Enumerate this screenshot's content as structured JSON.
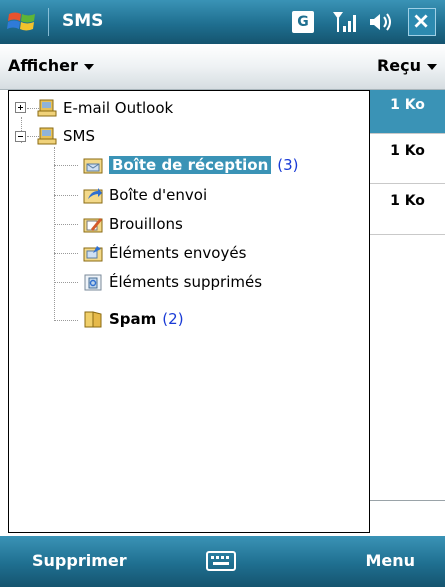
{
  "app": {
    "title": "SMS"
  },
  "status": {
    "network_letter": "G"
  },
  "menubar": {
    "left_label": "Afficher",
    "right_label": "Reçu"
  },
  "tree": {
    "items": [
      {
        "label": "E-mail Outlook",
        "count": "",
        "expand": "plus",
        "level": 0,
        "bold": false,
        "selected": false
      },
      {
        "label": "SMS",
        "count": "",
        "expand": "minus",
        "level": 0,
        "bold": false,
        "selected": false
      },
      {
        "label": "Boîte de réception",
        "count": "(3)",
        "expand": "",
        "level": 1,
        "bold": true,
        "selected": true
      },
      {
        "label": "Boîte d'envoi",
        "count": "",
        "expand": "",
        "level": 1,
        "bold": false,
        "selected": false
      },
      {
        "label": "Brouillons",
        "count": "",
        "expand": "",
        "level": 1,
        "bold": false,
        "selected": false
      },
      {
        "label": "Éléments envoyés",
        "count": "",
        "expand": "",
        "level": 1,
        "bold": false,
        "selected": false
      },
      {
        "label": "Éléments supprimés",
        "count": "",
        "expand": "",
        "level": 1,
        "bold": false,
        "selected": false
      },
      {
        "label": "Spam",
        "count": "(2)",
        "expand": "",
        "level": 1,
        "bold": true,
        "selected": false
      }
    ]
  },
  "message_sizes": [
    "1 Ko",
    "1 Ko",
    "1 Ko"
  ],
  "softkeys": {
    "left": "Supprimer",
    "right": "Menu"
  },
  "colors": {
    "bar_top": "#3a93b6",
    "bar_bottom": "#15546f",
    "selection": "#3a93b6",
    "count_blue": "#1a3bd6"
  }
}
